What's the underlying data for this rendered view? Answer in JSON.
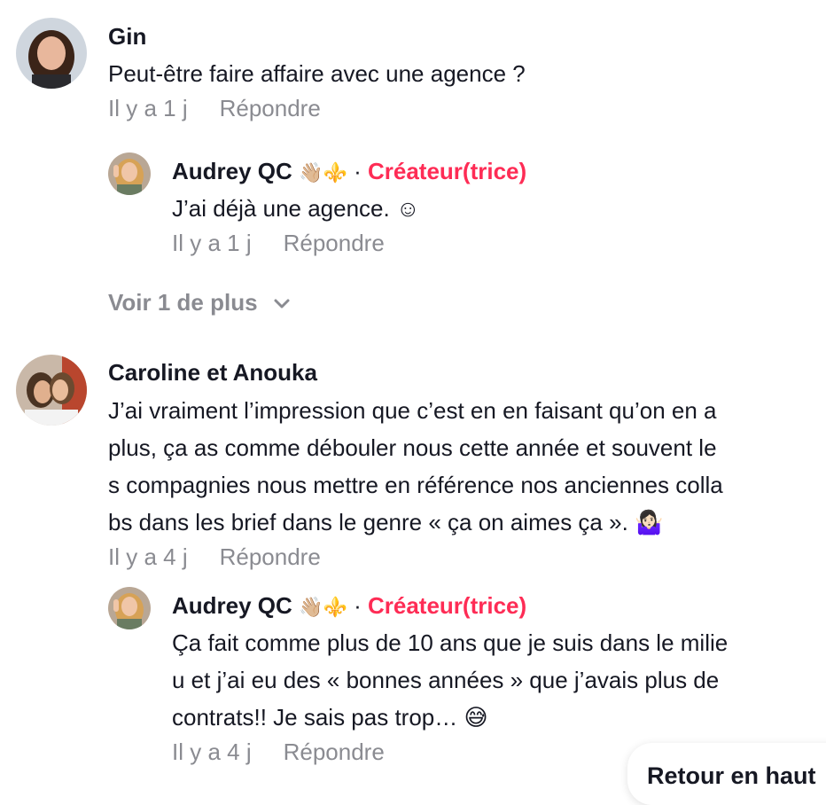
{
  "comments": [
    {
      "author": "Gin",
      "text": "Peut-être faire affaire avec une agence ?",
      "time": "Il y a 1 j",
      "reply_label": "Répondre",
      "replies": [
        {
          "author": "Audrey QC",
          "author_emoji": "👋🏼⚜️",
          "separator": "·",
          "badge": "Créateur(trice)",
          "text": "J’ai déjà une agence. ☺",
          "time": "Il y a 1 j",
          "reply_label": "Répondre"
        }
      ],
      "more_label": "Voir 1 de plus"
    },
    {
      "author": "Caroline et Anouka",
      "text_lines": [
        "J’ai vraiment l’impression que c’est en en faisant qu’on en a",
        "plus, ça as comme débouler nous cette année et souvent le",
        "s compagnies nous mettre en référence nos anciennes colla",
        "bs dans les brief dans le genre « ça on aimes ça ». 🤷🏻‍♀️"
      ],
      "time": "Il y a 4 j",
      "reply_label": "Répondre",
      "replies": [
        {
          "author": "Audrey QC",
          "author_emoji": "👋🏼⚜️",
          "separator": "·",
          "badge": "Créateur(trice)",
          "text_lines": [
            "Ça fait comme plus de 10 ans que je suis dans le milie",
            "u et j’ai eu des « bonnes années » que j’avais plus de",
            "contrats!! Je sais pas trop… 😅"
          ],
          "time": "Il y a 4 j",
          "reply_label": "Répondre"
        }
      ]
    }
  ],
  "back_to_top_label": "Retour en haut",
  "colors": {
    "creator_badge": "#fe2c55",
    "secondary_text": "#8a8b91",
    "primary_text": "#161823"
  },
  "icons": {
    "more_chevron": "chevron-down-icon"
  }
}
